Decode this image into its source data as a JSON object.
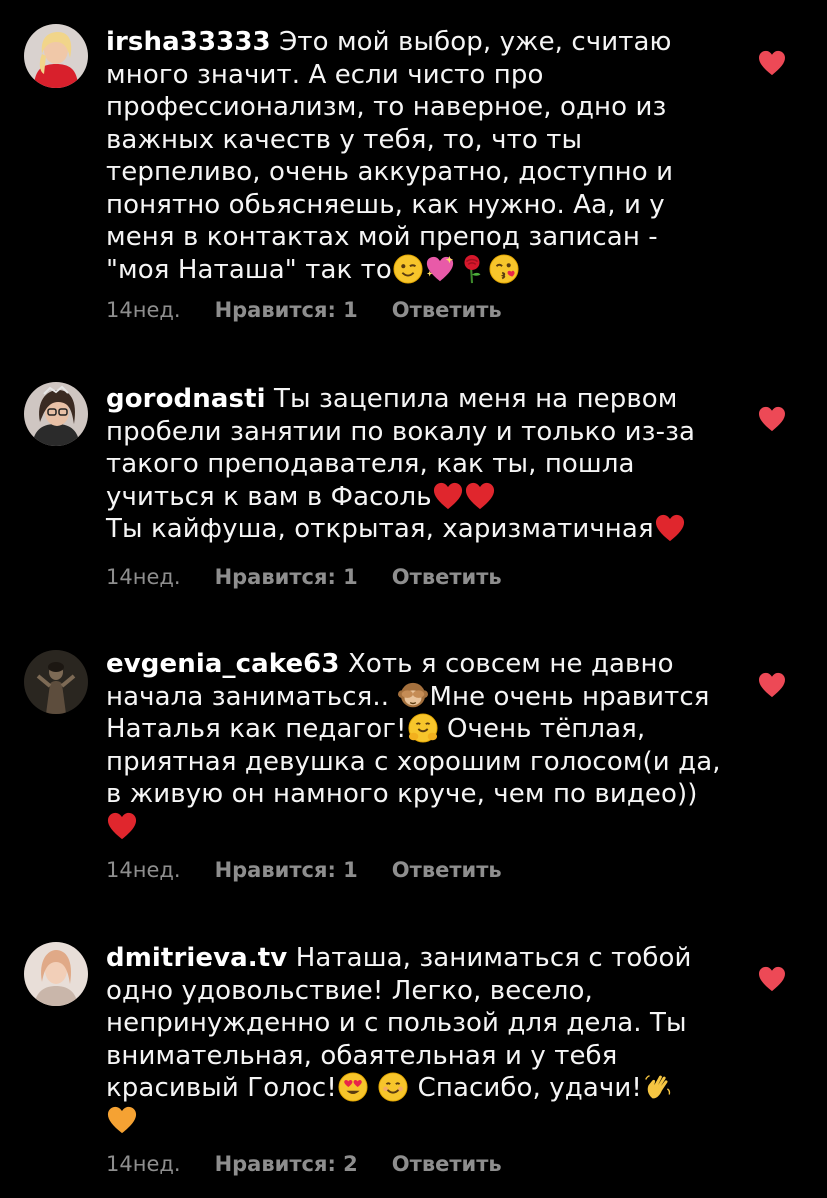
{
  "colors": {
    "background": "#000000",
    "text": "#f5f5f5",
    "meta": "#8e8e8e",
    "heart": "#ed4956"
  },
  "comments": [
    {
      "username": "irsha33333",
      "lines": [
        "Это мой выбор, уже, считаю",
        "много значит. А если чисто про",
        "профессионализм, то наверное, одно из",
        "важных качеств у тебя, то, что ты",
        "терпеливо, очень аккуратно, доступно и",
        "понятно обьясняешь, как нужно. Аа, и у",
        "меня в контактах мой препод записан -",
        "\"моя Наташа\" так то"
      ],
      "emojis": [
        "wink-emoji",
        "sparkling-heart-emoji",
        "rose-emoji",
        "kiss-face-emoji"
      ],
      "time": "14нед.",
      "likes": "Нравится: 1",
      "reply": "Ответить",
      "liked": true
    },
    {
      "username": "gorodnasti",
      "lines": [
        "Ты зацепила меня на первом",
        "пробели занятии по вокалу и только из-за",
        "такого преподавателя, как ты, пошла",
        "учиться к вам в Фасоль",
        "Ты кайфуша, открытая, харизматичная"
      ],
      "emojis": [
        "red-heart-emoji"
      ],
      "time": "14нед.",
      "likes": "Нравится: 1",
      "reply": "Ответить",
      "liked": true
    },
    {
      "username": "evgenia_cake63",
      "lines": [
        "Хоть я совсем не давно",
        "начала заниматься..",
        "Мне очень нравится",
        "Наталья как педагог!",
        "Очень тёплая,",
        "приятная девушка с хорошим голосом(и да,",
        "в живую он намного круче, чем по видео))"
      ],
      "emojis": [
        "see-no-evil-monkey-emoji",
        "hugging-face-emoji",
        "red-heart-emoji"
      ],
      "time": "14нед.",
      "likes": "Нравится: 1",
      "reply": "Ответить",
      "liked": true
    },
    {
      "username": "dmitrieva.tv",
      "lines": [
        "Наташа, заниматься с тобой",
        "одно удовольствие! Легко, весело,",
        "непринужденно и с пользой для дела. Ты",
        "внимательная,  обаятельная и  у тебя",
        "красивый Голос!",
        "Спасибо, удачи!"
      ],
      "emojis": [
        "heart-eyes-emoji",
        "smiling-face-emoji",
        "waving-hand-emoji",
        "orange-heart-emoji"
      ],
      "time": "14нед.",
      "likes": "Нравится: 2",
      "reply": "Ответить",
      "liked": true
    }
  ]
}
